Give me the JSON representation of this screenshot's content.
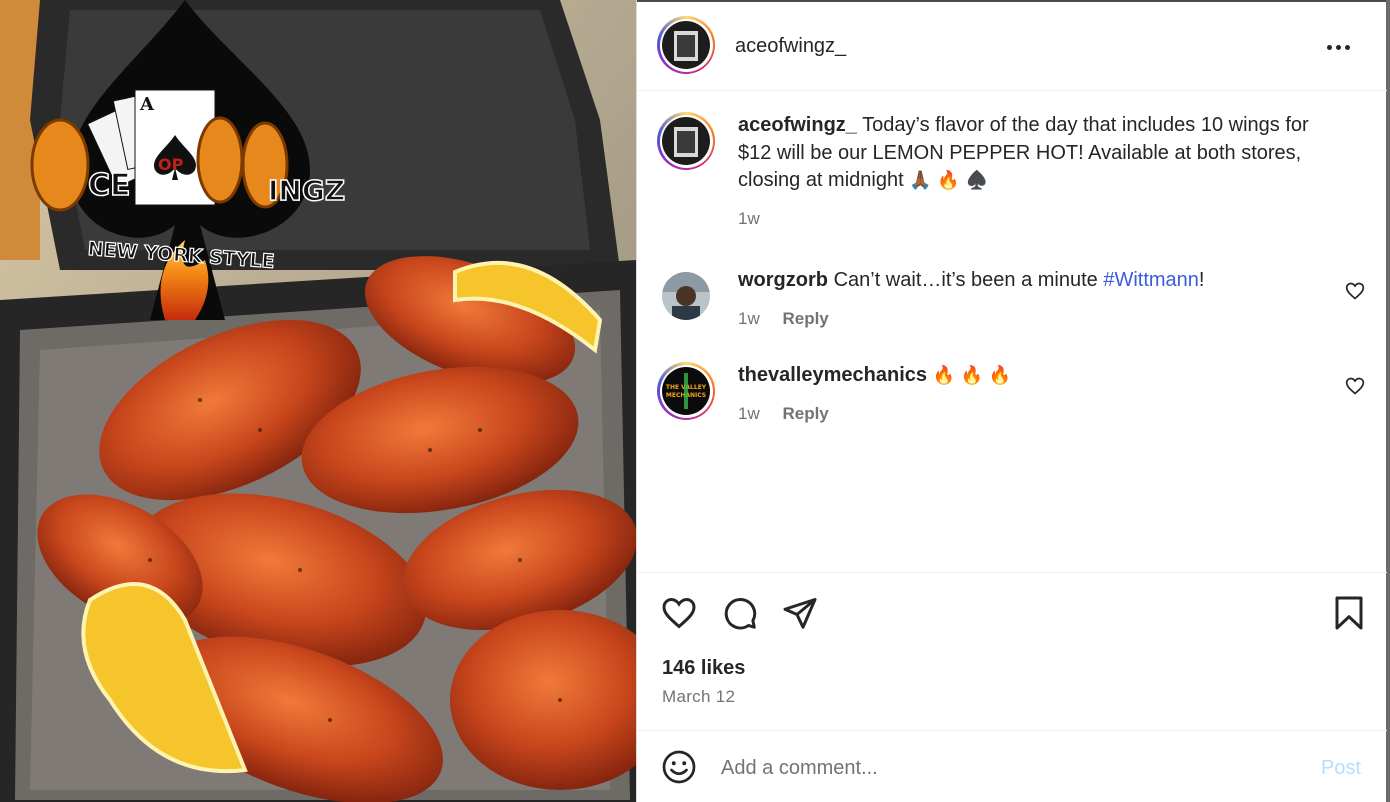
{
  "post": {
    "author": "aceofwingz_",
    "more_icon": "more-horizontal-icon",
    "image": {
      "logo_text_left": "CE",
      "logo_text_mid": "OP",
      "logo_text_right": "INGZ",
      "logo_sub": "NEW YORK STYLE",
      "colors": {
        "sauce": "#c0401a",
        "lemon": "#f6c52b",
        "container": "#2e2e2e"
      }
    }
  },
  "caption": {
    "username": "aceofwingz_",
    "text": "Today’s flavor of the day that includes 10 wings for $12 will be our LEMON PEPPER HOT! Available at both stores, closing at midnight",
    "emojis": "🙏🏾 🔥 ♠️",
    "time": "1w"
  },
  "comments": [
    {
      "username": "worgzorb",
      "text_before": "Can’t wait…it’s been a minute ",
      "hashtag": "#Wittmann",
      "text_after": "!",
      "time": "1w",
      "reply_label": "Reply"
    },
    {
      "username": "thevalleymechanics",
      "text": "🔥 🔥 🔥",
      "time": "1w",
      "reply_label": "Reply",
      "avatar_text": "THE VALLEY MECHANICS"
    }
  ],
  "actions": {
    "like_icon": "heart-icon",
    "comment_icon": "comment-bubble-icon",
    "share_icon": "paper-plane-icon",
    "save_icon": "bookmark-icon"
  },
  "likes": "146 likes",
  "date": "March 12",
  "add_comment": {
    "placeholder": "Add a comment...",
    "post_label": "Post",
    "emoji_icon": "smiley-icon"
  }
}
